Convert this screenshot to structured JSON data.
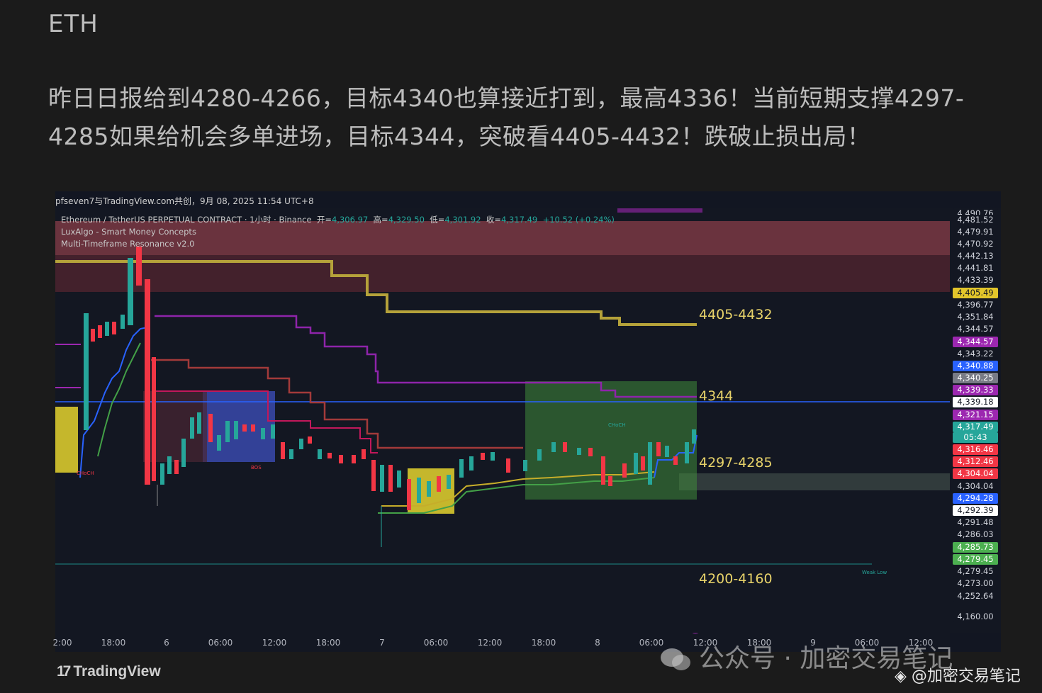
{
  "article": {
    "title": "ETH",
    "body": "昨日日报给到4280-4266，目标4340也算接近打到，最高4336！当前短期支撑4297-4285如果给机会多单进场，目标4344，突破看4405-4432！跌破止损出局！"
  },
  "chart": {
    "attribution": "pfseven7与TradingView.com共创，9月 08, 2025 11:54 UTC+8",
    "legend": {
      "symbol_line": "Ethereum / TetherUS PERPETUAL CONTRACT · 1小时 · Binance",
      "open_label": "开=",
      "open": "4,306.97",
      "high_label": "高=",
      "high": "4,329.50",
      "low_label": "低=",
      "low": "4,301.92",
      "close_label": "收=",
      "close": "4,317.49",
      "change": "+10.52 (+0.24%)",
      "indicator1": "LuxAlgo - Smart Money Concepts",
      "indicator2": "Multi-Timeframe Resonance v2.0"
    },
    "annotations": {
      "resistance": "4405-4432",
      "target": "4344",
      "support": "4297-4285",
      "lower": "4200-4160"
    },
    "small_labels": {
      "choch_left": "CHoCH",
      "bos": "BOS",
      "choch_right": "CHoCH",
      "weak_low": "Weak Low"
    },
    "price_labels": [
      {
        "text": "4,490.76",
        "bg": "#131722",
        "fg": "#d1d4dc"
      },
      {
        "text": "4,481.52",
        "bg": "#131722",
        "fg": "#d1d4dc"
      },
      {
        "text": "4,479.91",
        "bg": "#131722",
        "fg": "#d1d4dc"
      },
      {
        "text": "4,470.92",
        "bg": "#131722",
        "fg": "#d1d4dc"
      },
      {
        "text": "4,442.13",
        "bg": "#131722",
        "fg": "#d1d4dc"
      },
      {
        "text": "4,441.81",
        "bg": "#131722",
        "fg": "#d1d4dc"
      },
      {
        "text": "4,433.39",
        "bg": "#131722",
        "fg": "#d1d4dc"
      },
      {
        "text": "4,405.49",
        "bg": "#e2c52b",
        "fg": "#131722"
      },
      {
        "text": "4,396.77",
        "bg": "#131722",
        "fg": "#d1d4dc"
      },
      {
        "text": "4,351.84",
        "bg": "#131722",
        "fg": "#d1d4dc"
      },
      {
        "text": "4,344.57",
        "bg": "#131722",
        "fg": "#d1d4dc"
      },
      {
        "text": "4,344.57",
        "bg": "#9c27b0",
        "fg": "#ffffff"
      },
      {
        "text": "4,343.22",
        "bg": "#131722",
        "fg": "#d1d4dc"
      },
      {
        "text": "4,340.88",
        "bg": "#2962ff",
        "fg": "#ffffff"
      },
      {
        "text": "4,340.25",
        "bg": "#787b86",
        "fg": "#ffffff"
      },
      {
        "text": "4,339.33",
        "bg": "#9c27b0",
        "fg": "#ffffff"
      },
      {
        "text": "4,339.18",
        "bg": "#ffffff",
        "fg": "#131722"
      },
      {
        "text": "4,321.15",
        "bg": "#9c27b0",
        "fg": "#ffffff"
      },
      {
        "text": "4,317.49",
        "bg": "#26a69a",
        "fg": "#ffffff"
      },
      {
        "text": "05:43",
        "bg": "#26a69a",
        "fg": "#ffffff"
      },
      {
        "text": "4,316.46",
        "bg": "#f23645",
        "fg": "#ffffff"
      },
      {
        "text": "4,312.46",
        "bg": "#f23645",
        "fg": "#ffffff"
      },
      {
        "text": "4,304.04",
        "bg": "#f23645",
        "fg": "#ffffff"
      },
      {
        "text": "4,304.04",
        "bg": "#131722",
        "fg": "#d1d4dc"
      },
      {
        "text": "4,294.28",
        "bg": "#2962ff",
        "fg": "#ffffff"
      },
      {
        "text": "4,292.39",
        "bg": "#ffffff",
        "fg": "#131722"
      },
      {
        "text": "4,291.48",
        "bg": "#131722",
        "fg": "#d1d4dc"
      },
      {
        "text": "4,286.03",
        "bg": "#131722",
        "fg": "#d1d4dc"
      },
      {
        "text": "4,285.73",
        "bg": "#4caf50",
        "fg": "#ffffff"
      },
      {
        "text": "4,279.45",
        "bg": "#4caf50",
        "fg": "#ffffff"
      },
      {
        "text": "4,279.45",
        "bg": "#131722",
        "fg": "#d1d4dc"
      },
      {
        "text": "4,273.00",
        "bg": "#131722",
        "fg": "#d1d4dc"
      },
      {
        "text": "4,252.64",
        "bg": "#131722",
        "fg": "#d1d4dc"
      },
      {
        "text": "4,160.00",
        "bg": "#131722",
        "fg": "#d1d4dc"
      }
    ],
    "time_labels": [
      "2:00",
      "18:00",
      "6",
      "06:00",
      "12:00",
      "18:00",
      "7",
      "06:00",
      "12:00",
      "18:00",
      "8",
      "06:00",
      "12:00",
      "18:00",
      "9",
      "06:00",
      "12:00"
    ],
    "colors": {
      "bull": "#26a69a",
      "bear": "#f23645",
      "ema_yellow": "#b5a23a",
      "purple": "#9c27b0",
      "blue": "#2962ff",
      "green": "#43a047"
    }
  },
  "footer": {
    "tv_logo": "TradingView",
    "tv_mark": "17",
    "watermark": "公众号 · 加密交易笔记",
    "credit": "@加密交易笔记"
  }
}
